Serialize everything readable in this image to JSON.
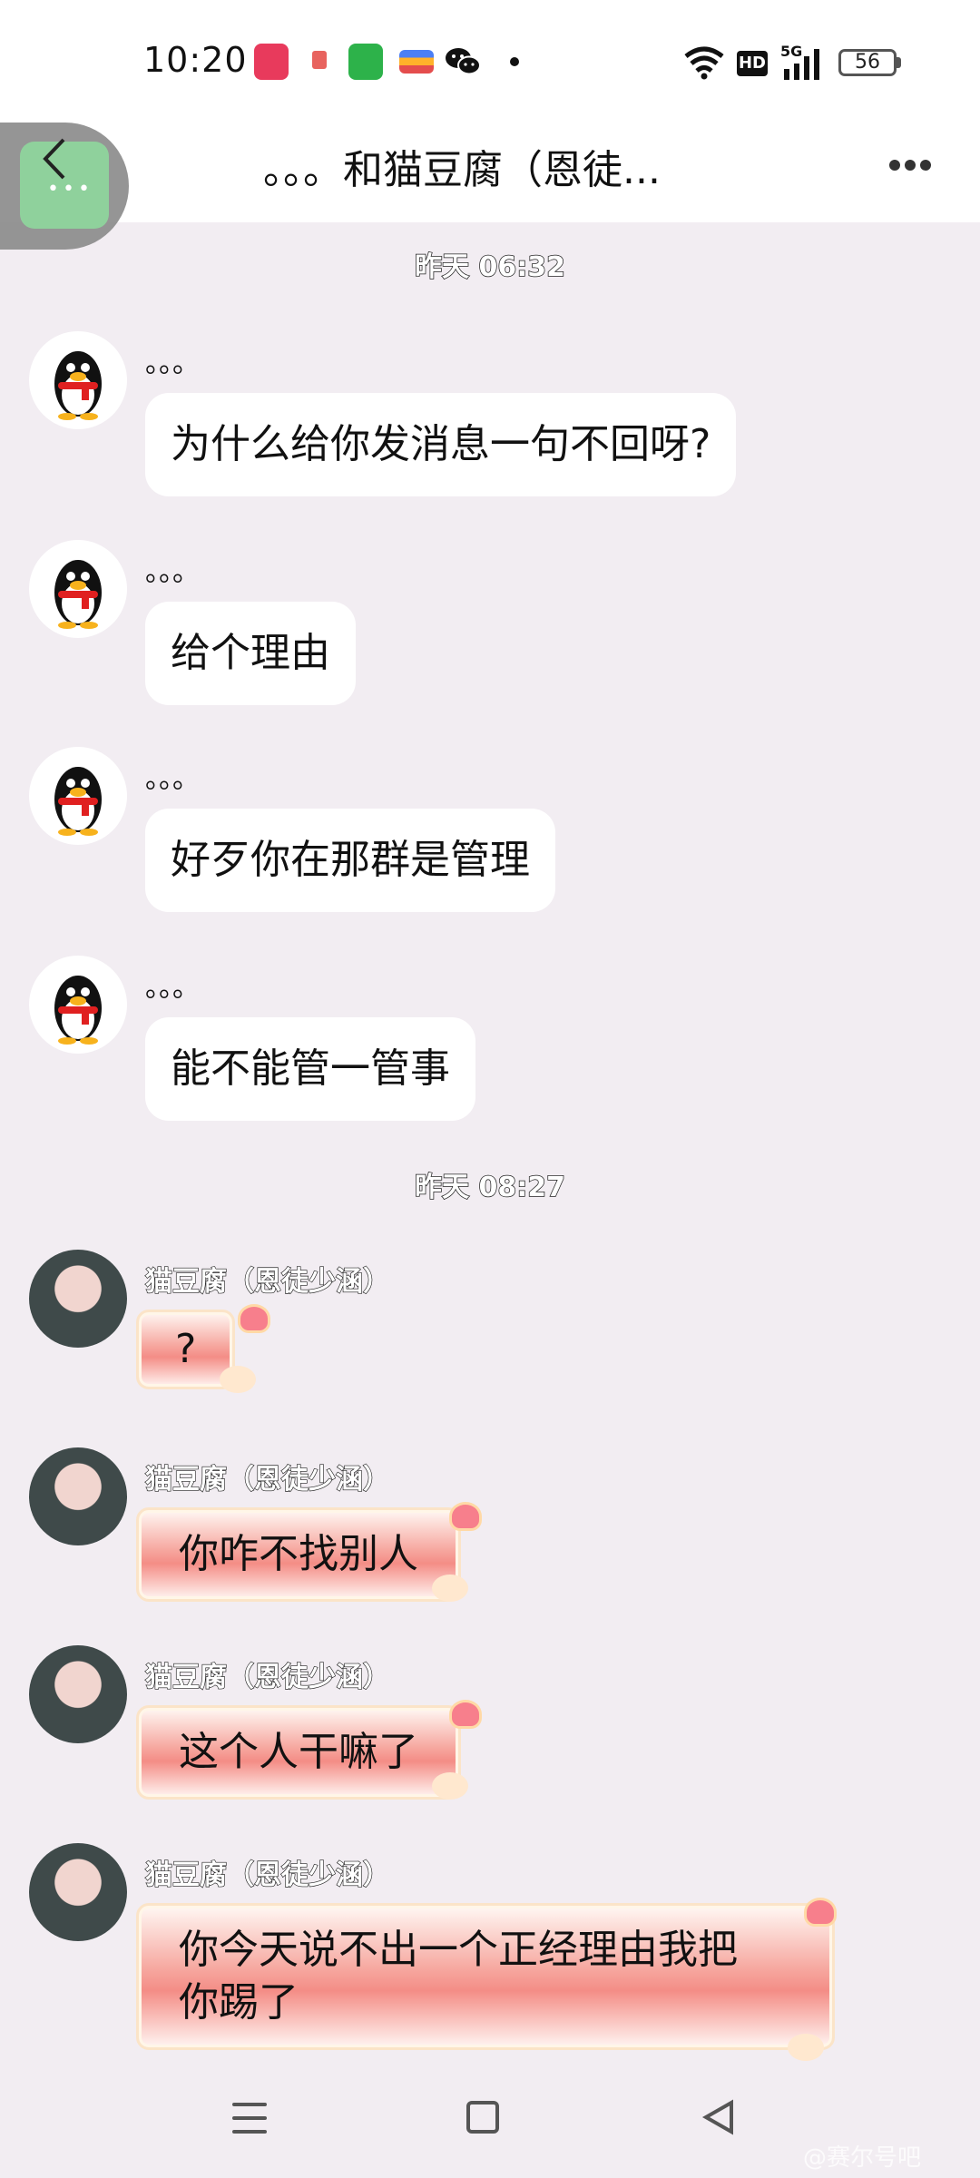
{
  "status_bar": {
    "time": "10:20",
    "battery": "56",
    "network": "5G",
    "hd": "HD"
  },
  "header": {
    "title": "。。。和猫豆腐（恩徒..."
  },
  "chat": {
    "timestamps": [
      "昨天 06:32",
      "昨天 08:27"
    ],
    "messages": [
      {
        "sender": "。。。",
        "text": "为什么给你发消息一句不回呀?",
        "avatar": "penguin"
      },
      {
        "sender": "。。。",
        "text": "给个理由",
        "avatar": "penguin"
      },
      {
        "sender": "。。。",
        "text": "好歹你在那群是管理",
        "avatar": "penguin"
      },
      {
        "sender": "。。。",
        "text": "能不能管一管事",
        "avatar": "penguin"
      },
      {
        "sender": "猫豆腐（恩徒少涵）",
        "text": "?",
        "avatar": "cat-girl"
      },
      {
        "sender": "猫豆腐（恩徒少涵）",
        "text": "你咋不找别人",
        "avatar": "cat-girl"
      },
      {
        "sender": "猫豆腐（恩徒少涵）",
        "text": "这个人干嘛了",
        "avatar": "cat-girl"
      },
      {
        "sender": "猫豆腐（恩徒少涵）",
        "text_line1": "你今天说不出一个正经理由我把",
        "text_line2": "你踢了",
        "avatar": "cat-girl"
      }
    ]
  },
  "watermark": "@赛尔号吧",
  "icons": [
    "music-icon",
    "wechat-icon",
    "wifi-icon",
    "signal-icon",
    "battery-icon",
    "back-icon",
    "more-icon",
    "menu-icon",
    "home-icon",
    "nav-back-icon"
  ],
  "colors": {
    "bubble": "#ffffff",
    "background": "#f2edf2",
    "pink_bubble": "#f48d86"
  }
}
